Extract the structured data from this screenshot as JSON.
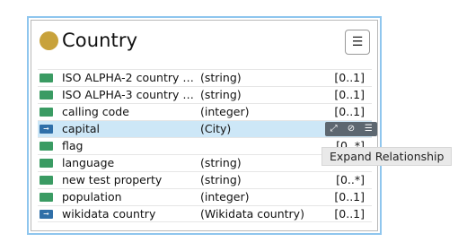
{
  "node": {
    "title": "Country",
    "class_color": "#c8a23b",
    "menu_icon": "hamburger-icon",
    "properties": [
      {
        "kind": "attribute",
        "name": "ISO ALPHA-2 country co...",
        "type": "(string)",
        "cardinality": "[0..1]"
      },
      {
        "kind": "attribute",
        "name": "ISO ALPHA-3 country co...",
        "type": "(string)",
        "cardinality": "[0..1]"
      },
      {
        "kind": "attribute",
        "name": "calling code",
        "type": "(integer)",
        "cardinality": "[0..1]"
      },
      {
        "kind": "relationship",
        "name": "capital",
        "type": "(City)",
        "cardinality": "",
        "selected": true
      },
      {
        "kind": "attribute",
        "name": "flag",
        "type": "",
        "cardinality": "[0..*]"
      },
      {
        "kind": "attribute",
        "name": "language",
        "type": "(string)",
        "cardinality": ""
      },
      {
        "kind": "attribute",
        "name": "new test property",
        "type": "(string)",
        "cardinality": "[0..*]"
      },
      {
        "kind": "attribute",
        "name": "population",
        "type": "(integer)",
        "cardinality": "[0..1]"
      },
      {
        "kind": "relationship",
        "name": "wikidata country",
        "type": "(Wikidata country)",
        "cardinality": "[0..1]"
      }
    ]
  },
  "row_actions": {
    "expand_icon": "expand-icon",
    "hide_icon": "eye-off-icon",
    "menu_icon": "hamburger-icon"
  },
  "tooltip": {
    "text": "Expand Relationship"
  },
  "colors": {
    "attribute_icon": "#3a9b63",
    "relationship_icon": "#2f6fa8",
    "selection": "#cde7f7",
    "frame": "#8fc6ee"
  }
}
